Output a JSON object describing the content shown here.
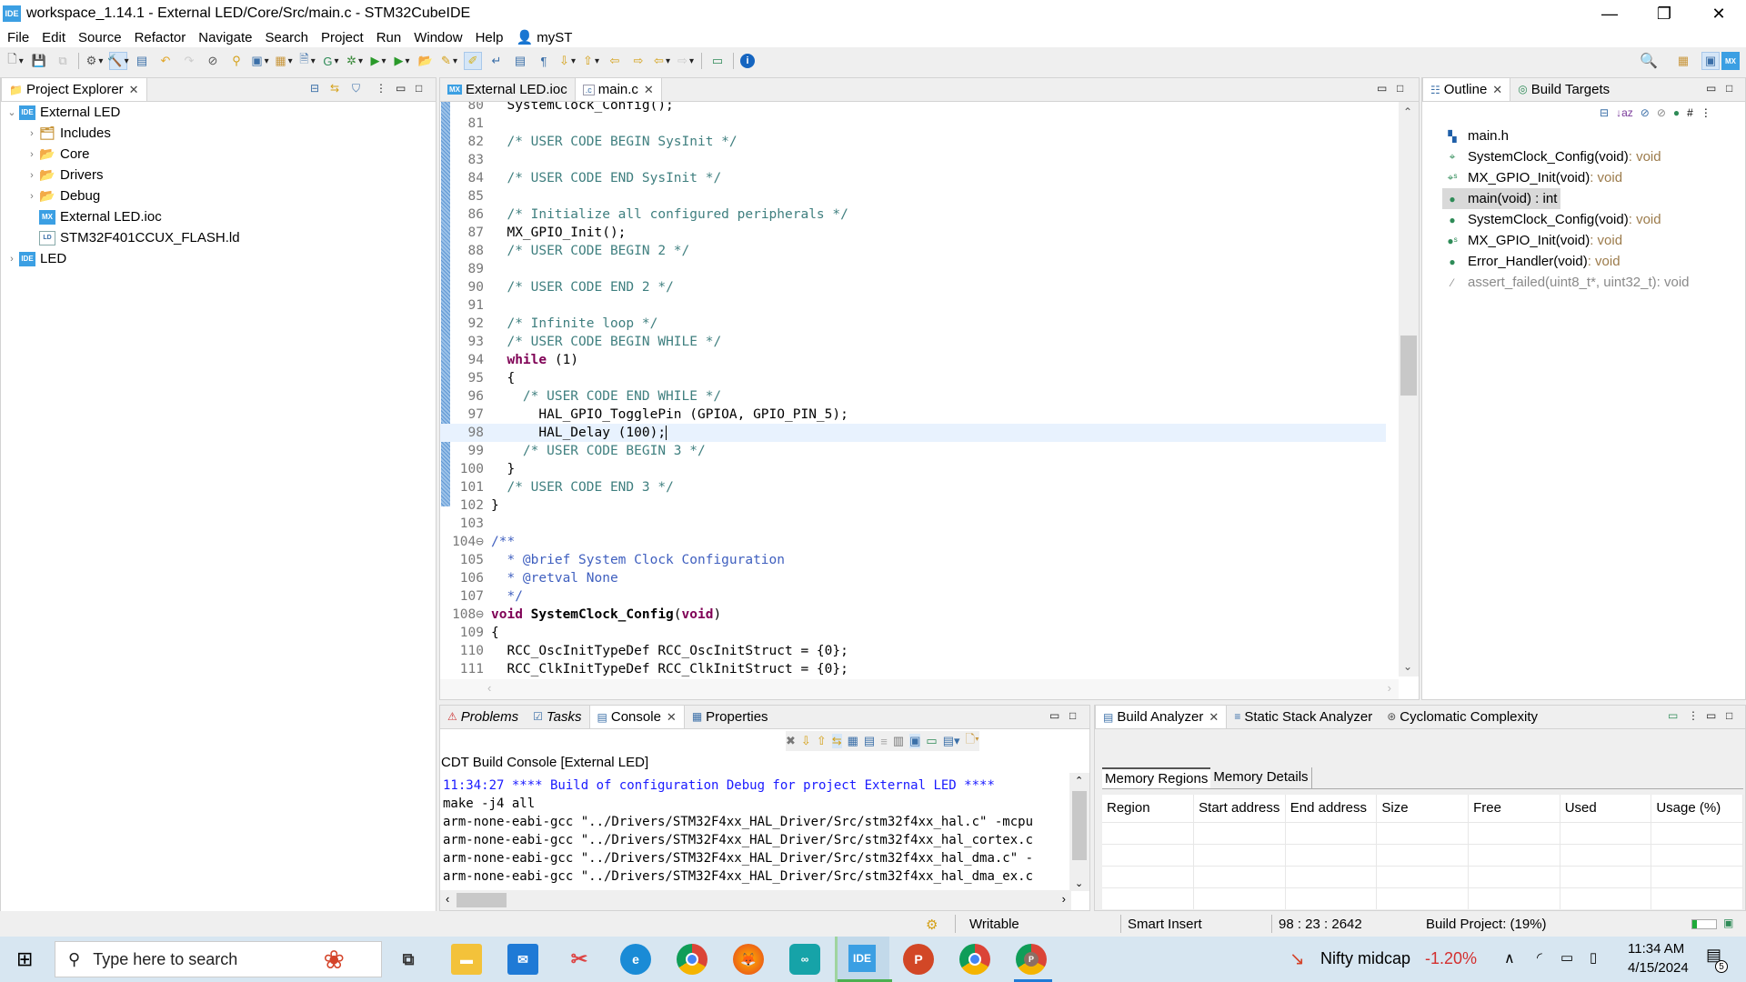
{
  "window": {
    "title": "workspace_1.14.1 - External LED/Core/Src/main.c - STM32CubeIDE",
    "app_icon": "IDE",
    "minimize": "—",
    "maximize": "❐",
    "close": "✕"
  },
  "menu": [
    "File",
    "Edit",
    "Source",
    "Refactor",
    "Navigate",
    "Search",
    "Project",
    "Run",
    "Window",
    "Help",
    "myST"
  ],
  "toolbar": {
    "icons": [
      "new-icon",
      "save-icon",
      "save-all-icon",
      "build-config-icon",
      "build-icon",
      "build-analyzer-icon",
      "undo-icon",
      "redo-icon",
      "skip-breakpoints-icon",
      "device-config-icon",
      "new-c-project-icon",
      "new-source-folder-icon",
      "new-c-file-icon",
      "new-class-icon",
      "debug-icon",
      "run-icon",
      "run-external-tool-icon",
      "open-perspective-icon",
      "search-tool-icon",
      "toggle-mark-occurrences-icon",
      "word-wrap-icon",
      "block-selection-icon",
      "whitespace-icon",
      "next-annotation-icon",
      "prev-annotation-icon",
      "last-edit-icon",
      "next-edit-icon",
      "back-icon",
      "forward-icon",
      "pin-editor-icon",
      "info-icon"
    ]
  },
  "project_explorer": {
    "title": "Project Explorer",
    "tree": [
      {
        "label": "External LED",
        "icon": "IDE",
        "expanded": true,
        "level": 0
      },
      {
        "label": "Includes",
        "icon": "includes",
        "level": 1,
        "has_children": true
      },
      {
        "label": "Core",
        "icon": "folder",
        "level": 1,
        "has_children": true
      },
      {
        "label": "Drivers",
        "icon": "folder",
        "level": 1,
        "has_children": true
      },
      {
        "label": "Debug",
        "icon": "folder",
        "level": 1,
        "has_children": true
      },
      {
        "label": "External LED.ioc",
        "icon": "MX",
        "level": 1
      },
      {
        "label": "STM32F401CCUX_FLASH.ld",
        "icon": "LD",
        "level": 1
      },
      {
        "label": "LED",
        "icon": "IDE",
        "level": 0,
        "has_children": true,
        "warning": true
      }
    ]
  },
  "editor": {
    "tabs": [
      {
        "label": "External LED.ioc",
        "icon": "MX",
        "active": false
      },
      {
        "label": "main.c",
        "icon": ".c",
        "active": true
      }
    ],
    "current_line": 98,
    "scroll_position": 0.45,
    "lines": [
      {
        "n": "80",
        "segs": [
          [
            "t",
            "  SystemClock_Config();"
          ]
        ]
      },
      {
        "n": "81",
        "segs": []
      },
      {
        "n": "82",
        "segs": [
          [
            "t",
            "  "
          ],
          [
            "c",
            "/* USER CODE BEGIN SysInit */"
          ]
        ]
      },
      {
        "n": "83",
        "segs": []
      },
      {
        "n": "84",
        "segs": [
          [
            "t",
            "  "
          ],
          [
            "c",
            "/* USER CODE END SysInit */"
          ]
        ]
      },
      {
        "n": "85",
        "segs": []
      },
      {
        "n": "86",
        "segs": [
          [
            "t",
            "  "
          ],
          [
            "c",
            "/* Initialize all configured peripherals */"
          ]
        ]
      },
      {
        "n": "87",
        "segs": [
          [
            "t",
            "  MX_GPIO_Init();"
          ]
        ]
      },
      {
        "n": "88",
        "segs": [
          [
            "t",
            "  "
          ],
          [
            "c",
            "/* USER CODE BEGIN 2 */"
          ]
        ]
      },
      {
        "n": "89",
        "segs": []
      },
      {
        "n": "90",
        "segs": [
          [
            "t",
            "  "
          ],
          [
            "c",
            "/* USER CODE END 2 */"
          ]
        ]
      },
      {
        "n": "91",
        "segs": []
      },
      {
        "n": "92",
        "segs": [
          [
            "t",
            "  "
          ],
          [
            "c",
            "/* Infinite loop */"
          ]
        ]
      },
      {
        "n": "93",
        "segs": [
          [
            "t",
            "  "
          ],
          [
            "c",
            "/* USER CODE BEGIN WHILE */"
          ]
        ]
      },
      {
        "n": "94",
        "segs": [
          [
            "t",
            "  "
          ],
          [
            "k",
            "while"
          ],
          [
            "t",
            " (1)"
          ]
        ]
      },
      {
        "n": "95",
        "segs": [
          [
            "t",
            "  {"
          ]
        ]
      },
      {
        "n": "96",
        "segs": [
          [
            "t",
            "    "
          ],
          [
            "c",
            "/* USER CODE END WHILE */"
          ]
        ]
      },
      {
        "n": "97",
        "segs": [
          [
            "t",
            "      HAL_GPIO_TogglePin (GPIOA, GPIO_PIN_5);"
          ]
        ]
      },
      {
        "n": "98",
        "segs": [
          [
            "t",
            "      HAL_Delay (100);"
          ]
        ]
      },
      {
        "n": "99",
        "segs": [
          [
            "t",
            "    "
          ],
          [
            "c",
            "/* USER CODE BEGIN 3 */"
          ]
        ]
      },
      {
        "n": "100",
        "segs": [
          [
            "t",
            "  }"
          ]
        ]
      },
      {
        "n": "101",
        "segs": [
          [
            "t",
            "  "
          ],
          [
            "c",
            "/* USER CODE END 3 */"
          ]
        ]
      },
      {
        "n": "102",
        "segs": [
          [
            "t",
            "}"
          ]
        ]
      },
      {
        "n": "103",
        "segs": []
      },
      {
        "n": "104⊖",
        "segs": [
          [
            "d",
            "/**"
          ]
        ]
      },
      {
        "n": "105",
        "segs": [
          [
            "d",
            "  * @brief System Clock Configuration"
          ]
        ]
      },
      {
        "n": "106",
        "segs": [
          [
            "d",
            "  * @retval None"
          ]
        ]
      },
      {
        "n": "107",
        "segs": [
          [
            "d",
            "  */"
          ]
        ]
      },
      {
        "n": "108⊖",
        "segs": [
          [
            "k",
            "void"
          ],
          [
            "t",
            " "
          ],
          [
            "f",
            "SystemClock_Config"
          ],
          [
            "t",
            "("
          ],
          [
            "k",
            "void"
          ],
          [
            "t",
            ")"
          ]
        ]
      },
      {
        "n": "109",
        "segs": [
          [
            "t",
            "{"
          ]
        ]
      },
      {
        "n": "110",
        "segs": [
          [
            "t",
            "  RCC_OscInitTypeDef RCC_OscInitStruct = {0};"
          ]
        ]
      },
      {
        "n": "111",
        "segs": [
          [
            "t",
            "  RCC_ClkInitTypeDef RCC_ClkInitStruct = {0};"
          ]
        ]
      }
    ]
  },
  "outline": {
    "tabs": [
      {
        "label": "Outline",
        "active": true
      },
      {
        "label": "Build Targets",
        "active": false
      }
    ],
    "items": [
      {
        "icon": "include",
        "label": "main.h",
        "type": ""
      },
      {
        "icon": "fn-decl",
        "label": "SystemClock_Config(void)",
        "type": " : void"
      },
      {
        "icon": "fn-decl-static",
        "label": "MX_GPIO_Init(void)",
        "type": " : void"
      },
      {
        "icon": "fn",
        "label": "main(void) : int",
        "type": "",
        "selected": true
      },
      {
        "icon": "fn",
        "label": "SystemClock_Config(void)",
        "type": " : void"
      },
      {
        "icon": "fn-static",
        "label": "MX_GPIO_Init(void)",
        "type": " : void"
      },
      {
        "icon": "fn",
        "label": "Error_Handler(void)",
        "type": " : void"
      },
      {
        "icon": "fn-disabled",
        "label": "assert_failed(uint8_t*, uint32_t)",
        "type": " : void",
        "disabled": true
      }
    ]
  },
  "console": {
    "tabs": [
      {
        "label": "Problems",
        "active": false
      },
      {
        "label": "Tasks",
        "active": false
      },
      {
        "label": "Console",
        "active": true
      },
      {
        "label": "Properties",
        "active": false
      }
    ],
    "header": "CDT Build Console [External LED]",
    "lines": [
      {
        "text": "11:34:27 **** Build of configuration Debug for project External LED ****",
        "kind": "hdr"
      },
      {
        "text": "make -j4 all",
        "kind": "out"
      },
      {
        "text": "arm-none-eabi-gcc \"../Drivers/STM32F4xx_HAL_Driver/Src/stm32f4xx_hal.c\" -mcpu",
        "kind": "out"
      },
      {
        "text": "arm-none-eabi-gcc \"../Drivers/STM32F4xx_HAL_Driver/Src/stm32f4xx_hal_cortex.c",
        "kind": "out"
      },
      {
        "text": "arm-none-eabi-gcc \"../Drivers/STM32F4xx_HAL_Driver/Src/stm32f4xx_hal_dma.c\" -",
        "kind": "out"
      },
      {
        "text": "arm-none-eabi-gcc \"../Drivers/STM32F4xx_HAL_Driver/Src/stm32f4xx_hal_dma_ex.c",
        "kind": "out"
      }
    ]
  },
  "build_analyzer": {
    "tabs": [
      {
        "label": "Build Analyzer",
        "active": true
      },
      {
        "label": "Static Stack Analyzer",
        "active": false
      },
      {
        "label": "Cyclomatic Complexity",
        "active": false
      }
    ],
    "subtabs": [
      "Memory Regions",
      "Memory Details"
    ],
    "columns": [
      "Region",
      "Start address",
      "End address",
      "Size",
      "Free",
      "Used",
      "Usage (%)"
    ],
    "rows": []
  },
  "statusbar": {
    "writable": "Writable",
    "insert_mode": "Smart Insert",
    "position": "98 : 23 : 2642",
    "build_progress_label": "Build Project: (19%)",
    "build_progress": 0.19
  },
  "taskbar": {
    "search_placeholder": "Type here to search",
    "apps": [
      "task-view",
      "file-explorer",
      "mail",
      "snipping-tool",
      "edge",
      "chrome",
      "firefox",
      "arduino",
      "stm32cubeide",
      "powerpoint",
      "chrome-profile-1",
      "chrome-profile-2"
    ],
    "ticker_name": "Nifty midcap",
    "ticker_change": "-1.20%",
    "time": "11:34 AM",
    "date": "4/15/2024",
    "notification_count": "5"
  },
  "colors": {
    "accent": "#3b9fe3",
    "comment": "#3f7f7f",
    "keyword": "#7f0055",
    "ticker_negative": "#d32f2f",
    "console_header": "#1a1aff"
  }
}
